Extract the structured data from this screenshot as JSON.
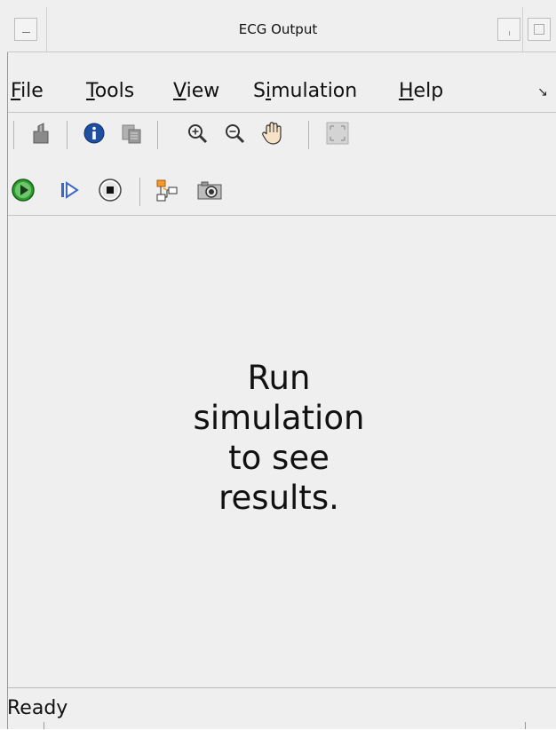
{
  "window": {
    "title": "ECG Output"
  },
  "menubar": {
    "items": [
      {
        "mnemonic": "F",
        "rest": "ile"
      },
      {
        "mnemonic": "T",
        "rest": "ools"
      },
      {
        "mnemonic": "V",
        "rest": "iew"
      },
      {
        "pre": "S",
        "mnemonic": "i",
        "rest": "mulation"
      },
      {
        "mnemonic": "H",
        "rest": "elp"
      }
    ],
    "overflow_arrow": "↘"
  },
  "toolbar_row1": {
    "icons": [
      "parameters-icon",
      "info-icon",
      "copy-icon",
      "zoom-in-icon",
      "zoom-out-icon",
      "pan-hand-icon",
      "fit-to-view-icon"
    ]
  },
  "toolbar_row2": {
    "icons": [
      "run-icon",
      "step-forward-icon",
      "stop-icon",
      "highlight-model-icon",
      "snapshot-camera-icon"
    ]
  },
  "content": {
    "message_lines": [
      "Run",
      "simulation",
      "to see",
      "results."
    ]
  },
  "statusbar": {
    "text": "Ready"
  },
  "colors": {
    "background": "#efefef",
    "run_green": "#2e9e2e",
    "info_blue": "#1f4fa0"
  }
}
